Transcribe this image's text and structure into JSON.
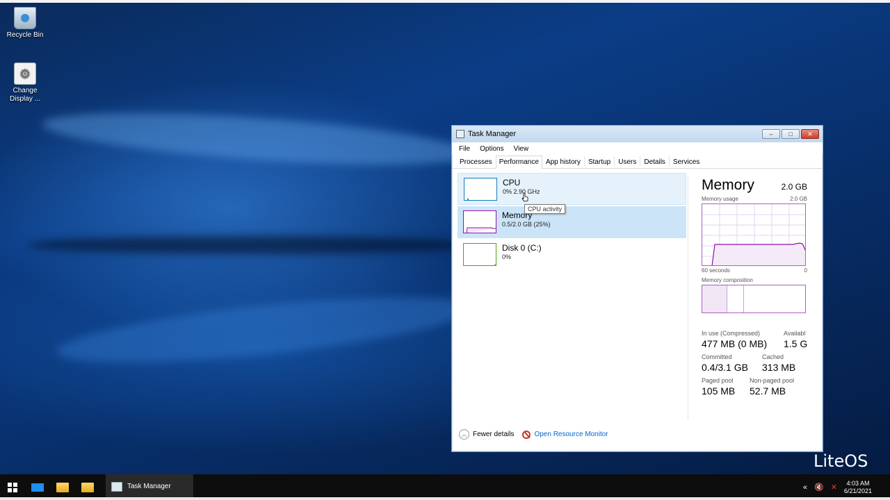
{
  "desktop": {
    "icons": [
      {
        "label": "Recycle Bin"
      },
      {
        "label": "Change Display ..."
      }
    ]
  },
  "window": {
    "title": "Task Manager",
    "menu": [
      "File",
      "Options",
      "View"
    ],
    "tabs": [
      "Processes",
      "Performance",
      "App history",
      "Startup",
      "Users",
      "Details",
      "Services"
    ],
    "active_tab": "Performance",
    "perf_items": [
      {
        "title": "CPU",
        "sub": "0% 2.90 GHz"
      },
      {
        "title": "Memory",
        "sub": "0.5/2.0 GB (25%)"
      },
      {
        "title": "Disk 0 (C:)",
        "sub": "0%"
      }
    ],
    "tooltip": "CPU activity",
    "memory": {
      "title": "Memory",
      "total": "2.0 GB",
      "usage_label": "Memory usage",
      "usage_max": "2.0 GB",
      "axis_left": "60 seconds",
      "axis_right": "0",
      "composition_label": "Memory composition",
      "stats": [
        {
          "label": "In use (Compressed)",
          "value": "477 MB (0 MB)"
        },
        {
          "label": "Availabl",
          "value": "1.5 G"
        },
        {
          "label": "Committed",
          "value": "0.4/3.1 GB"
        },
        {
          "label": "Cached",
          "value": "313 MB"
        },
        {
          "label": "Paged pool",
          "value": "105 MB"
        },
        {
          "label": "Non-paged pool",
          "value": "52.7 MB"
        }
      ]
    },
    "footer": {
      "fewer_details": "Fewer details",
      "open_resource_monitor": "Open Resource Monitor"
    }
  },
  "watermark": "LiteOS",
  "taskbar": {
    "task_label": "Task Manager",
    "time": "4:03 AM",
    "date": "6/21/2021"
  }
}
